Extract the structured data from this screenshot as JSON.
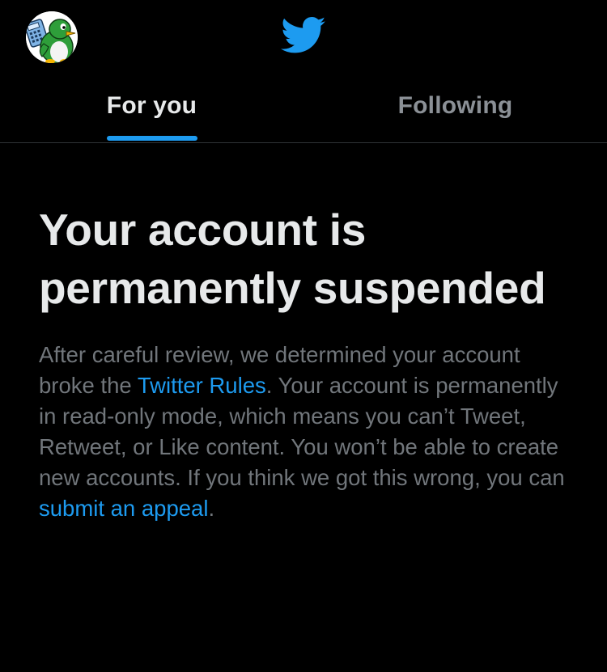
{
  "header": {
    "avatar_icon": "penguin-avatar-icon",
    "logo_icon": "twitter-bird-icon",
    "brand_color": "#1d9bf0"
  },
  "tabs": [
    {
      "label": "For you",
      "active": true
    },
    {
      "label": "Following",
      "active": false
    }
  ],
  "notice": {
    "headline": "Your account is permanently suspended",
    "body_before_rules": "After careful review, we determined your account broke the ",
    "rules_link": "Twitter Rules",
    "body_middle": ". Your account is permanently in read-only mode, which means you can’t Tweet, Retweet, or Like content. You won’t be able to create new accounts. If you think we got this wrong, you can ",
    "appeal_link": "submit an appeal",
    "body_end": "."
  },
  "colors": {
    "background": "#000000",
    "text_primary": "#e7e9ea",
    "text_secondary": "#71767b",
    "link": "#1d9bf0",
    "divider": "#2f3336"
  }
}
